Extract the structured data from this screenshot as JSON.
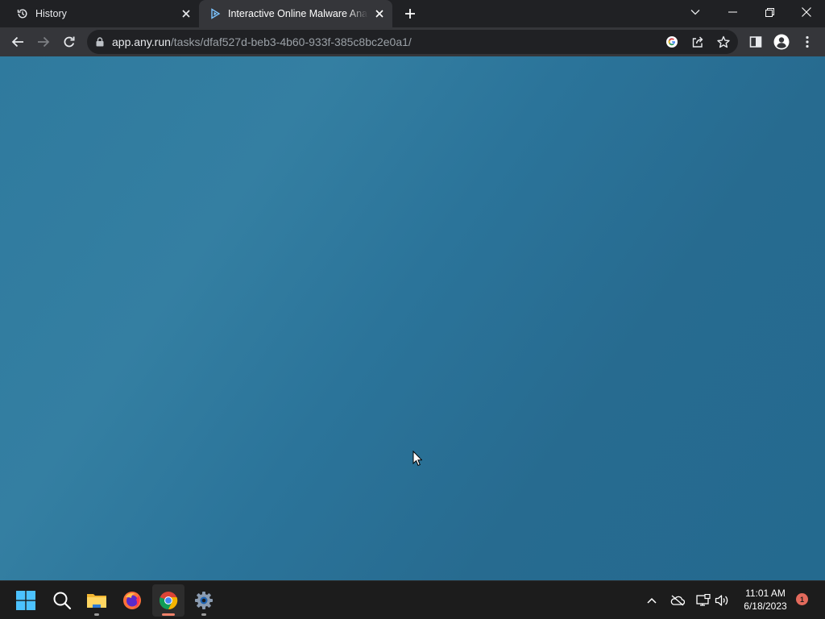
{
  "browser": {
    "tabs": [
      {
        "title": "History",
        "icon": "history-icon",
        "active": false
      },
      {
        "title": "Interactive Online Malware Analy",
        "icon": "anyrun-icon",
        "active": true
      }
    ],
    "address": {
      "host": "app.any.run",
      "path": "/tasks/dfaf527d-beb3-4b60-933f-385c8bc2e0a1/"
    }
  },
  "content": {
    "background_color": "#2e789c"
  },
  "taskbar": {
    "apps": [
      "windows-start",
      "search",
      "file-explorer",
      "firefox",
      "chrome",
      "settings"
    ],
    "clock": {
      "time": "11:01 AM",
      "date": "6/18/2023"
    },
    "notification_count": "1"
  },
  "colors": {
    "accent": "#f0826a",
    "tab_strip": "#202124",
    "toolbar": "#35363a"
  }
}
